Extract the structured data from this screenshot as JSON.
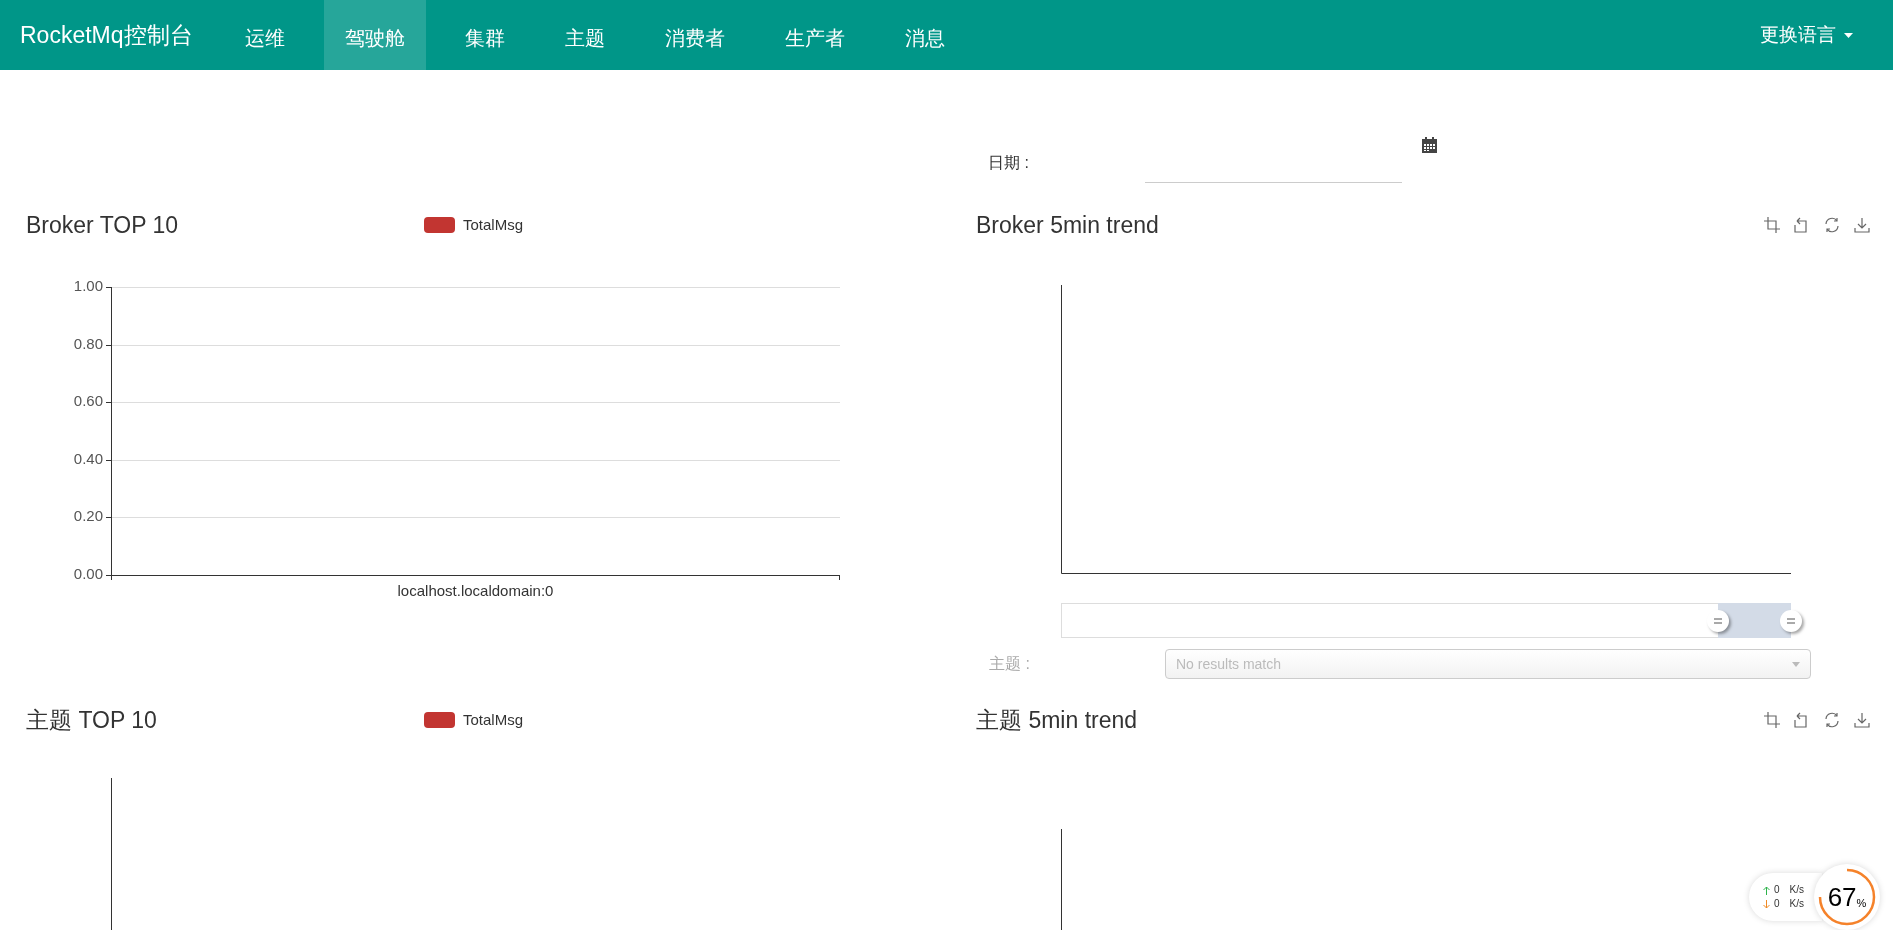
{
  "navbar": {
    "brand": "RocketMq控制台",
    "items": [
      {
        "label": "运维",
        "selected": false
      },
      {
        "label": "驾驶舱",
        "selected": true
      },
      {
        "label": "集群",
        "selected": false
      },
      {
        "label": "主题",
        "selected": false
      },
      {
        "label": "消费者",
        "selected": false
      },
      {
        "label": "生产者",
        "selected": false
      },
      {
        "label": "消息",
        "selected": false
      }
    ],
    "language_menu": "更换语言"
  },
  "date_filter": {
    "label": "日期 :"
  },
  "broker_top": {
    "title": "Broker TOP 10",
    "chart_data": {
      "type": "bar",
      "grid": true,
      "categories": [
        "localhost.localdomain:0"
      ],
      "series": [
        {
          "name": "TotalMsg",
          "color": "#c23531",
          "values": [
            0
          ]
        }
      ],
      "ylim": [
        0,
        1
      ],
      "yticks": [
        {
          "value": 0,
          "label": "0.00"
        },
        {
          "value": 0.2,
          "label": "0.20"
        },
        {
          "value": 0.4,
          "label": "0.40"
        },
        {
          "value": 0.6,
          "label": "0.60"
        },
        {
          "value": 0.8,
          "label": "0.80"
        },
        {
          "value": 1,
          "label": "1.00"
        }
      ]
    }
  },
  "broker_trend": {
    "title": "Broker 5min trend",
    "zoom_window": {
      "start": {
        "level": 0.9
      },
      "end": {
        "level": 1
      }
    }
  },
  "topic_filter": {
    "label": "主题 :",
    "placeholder": "No results match",
    "disabled": true
  },
  "topic_top": {
    "title": "主题 TOP 10",
    "legend": {
      "label": "TotalMsg",
      "color": "#c23531"
    }
  },
  "topic_trend": {
    "title": "主题 5min trend"
  },
  "net_widget": {
    "upload": "0",
    "upload_unit": "K/s",
    "download": "0",
    "download_unit": "K/s",
    "percent": "67",
    "percent_sign": "%"
  }
}
